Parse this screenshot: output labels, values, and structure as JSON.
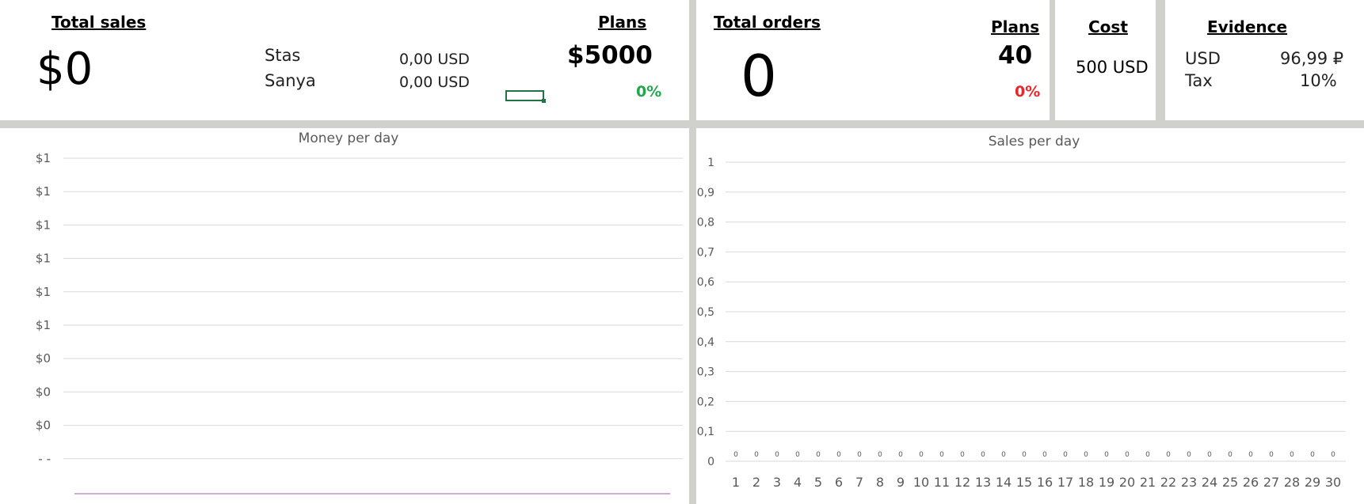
{
  "kpi": {
    "total_sales": {
      "title": "Total sales",
      "value": "$0",
      "people": [
        {
          "name": "Stas",
          "amount": "0,00 USD"
        },
        {
          "name": "Sanya",
          "amount": "0,00 USD"
        }
      ],
      "plans_title": "Plans",
      "plans_value": "$5000",
      "plans_pct": "0%",
      "progress_fraction": 0
    },
    "total_orders": {
      "title": "Total orders",
      "value": "0",
      "plans_title": "Plans",
      "plans_value": "40",
      "plans_pct": "0%"
    },
    "cost": {
      "title": "Cost",
      "value": "500 USD"
    },
    "evidence": {
      "title": "Evidence",
      "rows": [
        {
          "label": "USD",
          "value": "96,99 ₽"
        },
        {
          "label": "Tax",
          "value": "10%"
        }
      ]
    }
  },
  "charts": {
    "colors": {
      "grid": "#d9d9d9",
      "line": "#9b5fa0",
      "text": "#595959"
    }
  },
  "chart_data": [
    {
      "type": "line",
      "title": "Money per day",
      "y_tick_labels": [
        "$1",
        "$1",
        "$1",
        "$1",
        "$1",
        "$1",
        "$0",
        "$0",
        "$0",
        "- -"
      ],
      "x": [],
      "series": [
        {
          "values": []
        }
      ],
      "grid": true
    },
    {
      "type": "line",
      "title": "Sales per day",
      "x": [
        1,
        2,
        3,
        4,
        5,
        6,
        7,
        8,
        9,
        10,
        11,
        12,
        13,
        14,
        15,
        16,
        17,
        18,
        19,
        20,
        21,
        22,
        23,
        24,
        25,
        26,
        27,
        28,
        29,
        30
      ],
      "y_tick_labels": [
        "1",
        "0,9",
        "0,8",
        "0,7",
        "0,6",
        "0,5",
        "0,4",
        "0,3",
        "0,2",
        "0,1",
        "0"
      ],
      "ylim": [
        0,
        1
      ],
      "series": [
        {
          "values": [
            0,
            0,
            0,
            0,
            0,
            0,
            0,
            0,
            0,
            0,
            0,
            0,
            0,
            0,
            0,
            0,
            0,
            0,
            0,
            0,
            0,
            0,
            0,
            0,
            0,
            0,
            0,
            0,
            0,
            0
          ],
          "data_labels": [
            "0",
            "0",
            "0",
            "0",
            "0",
            "0",
            "0",
            "0",
            "0",
            "0",
            "0",
            "0",
            "0",
            "0",
            "0",
            "0",
            "0",
            "0",
            "0",
            "0",
            "0",
            "0",
            "0",
            "0",
            "0",
            "0",
            "0",
            "0",
            "0",
            "0"
          ]
        }
      ],
      "grid": true
    }
  ]
}
